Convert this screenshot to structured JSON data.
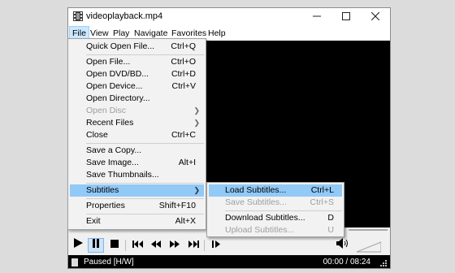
{
  "window": {
    "title": "videoplayback.mp4"
  },
  "menubar": [
    "File",
    "View",
    "Play",
    "Navigate",
    "Favorites",
    "Help"
  ],
  "file_menu": [
    {
      "label": "Quick Open File...",
      "shortcut": "Ctrl+Q"
    },
    {
      "label": "Open File...",
      "shortcut": "Ctrl+O"
    },
    {
      "label": "Open DVD/BD...",
      "shortcut": "Ctrl+D"
    },
    {
      "label": "Open Device...",
      "shortcut": "Ctrl+V"
    },
    {
      "label": "Open Directory...",
      "shortcut": ""
    },
    {
      "label": "Open Disc",
      "shortcut": ""
    },
    {
      "label": "Recent Files",
      "shortcut": ""
    },
    {
      "label": "Close",
      "shortcut": "Ctrl+C"
    },
    {
      "label": "Save a Copy...",
      "shortcut": ""
    },
    {
      "label": "Save Image...",
      "shortcut": "Alt+I"
    },
    {
      "label": "Save Thumbnails...",
      "shortcut": ""
    },
    {
      "label": "Subtitles",
      "shortcut": ""
    },
    {
      "label": "Properties",
      "shortcut": "Shift+F10"
    },
    {
      "label": "Exit",
      "shortcut": "Alt+X"
    }
  ],
  "subtitles_menu": [
    {
      "label": "Load Subtitles...",
      "shortcut": "Ctrl+L"
    },
    {
      "label": "Save Subtitles...",
      "shortcut": "Ctrl+S"
    },
    {
      "label": "Download Subtitles...",
      "shortcut": "D"
    },
    {
      "label": "Upload Subtitles...",
      "shortcut": "U"
    }
  ],
  "status": {
    "text": "Paused [H/W]",
    "time": "00:00 / 08:24"
  },
  "colors": {
    "highlight": "#91c9f7",
    "active_menu": "#cce8ff",
    "video_bg": "#000000"
  }
}
